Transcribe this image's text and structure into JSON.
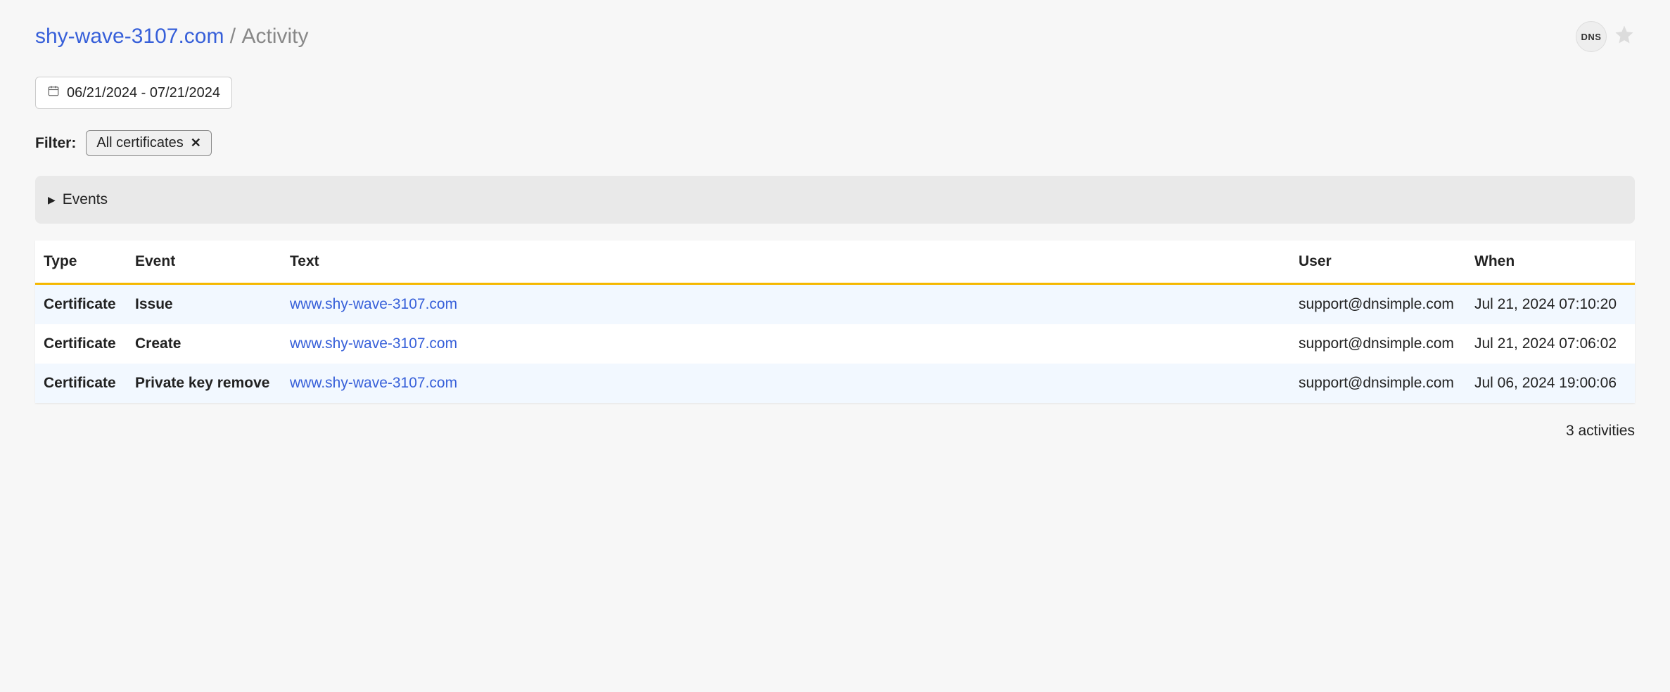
{
  "breadcrumb": {
    "domain": "shy-wave-3107.com",
    "separator": "/",
    "current": "Activity"
  },
  "header": {
    "dns_badge": "DNS"
  },
  "date_range": "06/21/2024 - 07/21/2024",
  "filter": {
    "label": "Filter:",
    "chip_text": "All certificates"
  },
  "events_accordion": "Events",
  "table": {
    "headers": {
      "type": "Type",
      "event": "Event",
      "text": "Text",
      "user": "User",
      "when": "When"
    },
    "rows": [
      {
        "type": "Certificate",
        "event": "Issue",
        "text": "www.shy-wave-3107.com",
        "user": "support@dnsimple.com",
        "when": "Jul 21, 2024 07:10:20"
      },
      {
        "type": "Certificate",
        "event": "Create",
        "text": "www.shy-wave-3107.com",
        "user": "support@dnsimple.com",
        "when": "Jul 21, 2024 07:06:02"
      },
      {
        "type": "Certificate",
        "event": "Private key remove",
        "text": "www.shy-wave-3107.com",
        "user": "support@dnsimple.com",
        "when": "Jul 06, 2024 19:00:06"
      }
    ]
  },
  "summary": "3 activities"
}
